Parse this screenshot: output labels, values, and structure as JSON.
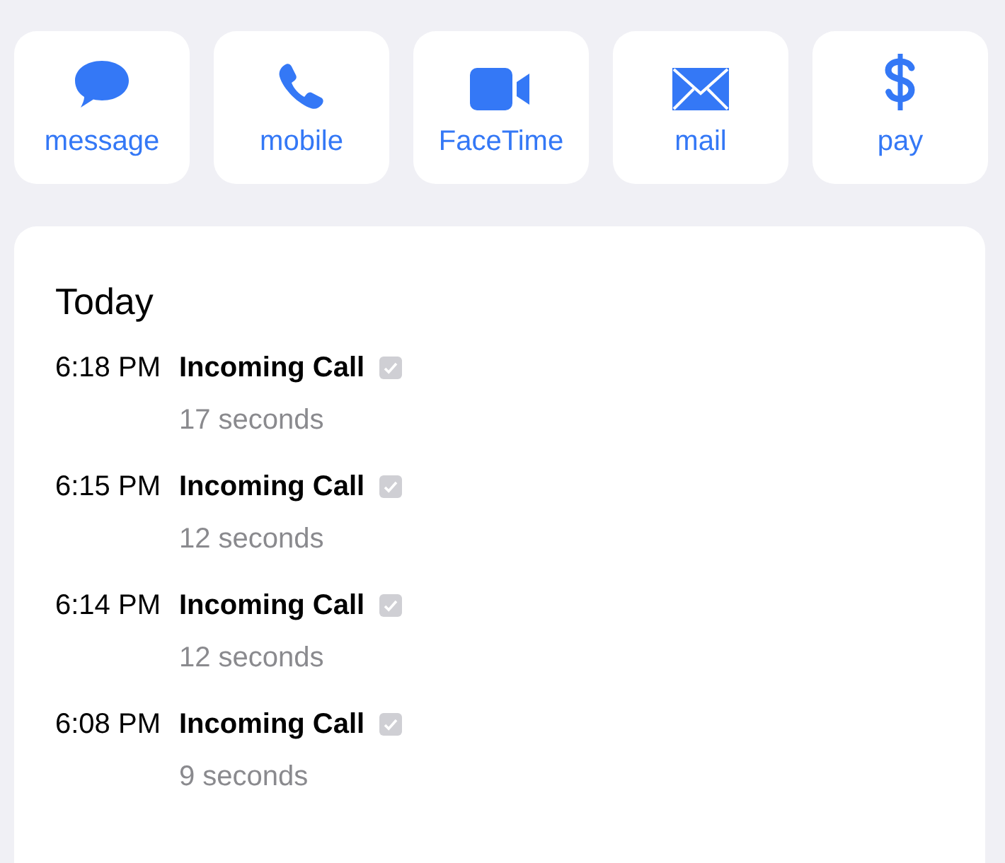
{
  "actions": [
    {
      "kind": "message",
      "label": "message"
    },
    {
      "kind": "phone",
      "label": "mobile"
    },
    {
      "kind": "video",
      "label": "FaceTime"
    },
    {
      "kind": "mail",
      "label": "mail"
    },
    {
      "kind": "pay",
      "label": "pay"
    }
  ],
  "history": {
    "title": "Today",
    "calls": [
      {
        "time": "6:18 PM",
        "type": "Incoming Call",
        "duration": "17 seconds"
      },
      {
        "time": "6:15 PM",
        "type": "Incoming Call",
        "duration": "12 seconds"
      },
      {
        "time": "6:14 PM",
        "type": "Incoming Call",
        "duration": "12 seconds"
      },
      {
        "time": "6:08 PM",
        "type": "Incoming Call",
        "duration": "9 seconds"
      }
    ]
  }
}
